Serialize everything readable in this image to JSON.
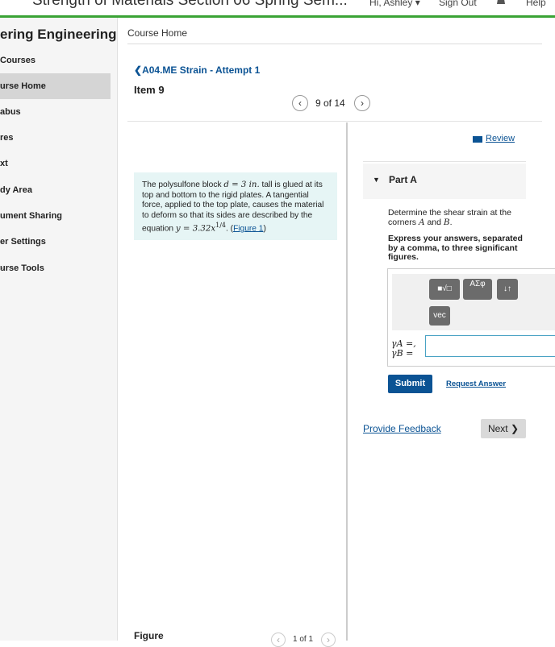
{
  "topbar": {
    "course_title": "Strength of Materials Section 06 Spring Sem...",
    "user_menu": "Hi, Ashley ▾",
    "sign_out": "Sign Out",
    "help": "Help"
  },
  "sidebar": {
    "brand": "ering Engineering",
    "items": [
      {
        "label": "Courses"
      },
      {
        "label": "urse Home"
      },
      {
        "label": "abus"
      },
      {
        "label": "res"
      },
      {
        "label": "xt"
      },
      {
        "label": "dy Area"
      },
      {
        "label": "ument Sharing"
      },
      {
        "label": "er Settings"
      },
      {
        "label": "urse Tools"
      }
    ],
    "active_index": 1
  },
  "breadcrumb": "Course Home",
  "assignment": {
    "back_link": "A04.ME Strain - Attempt 1",
    "item_title": "Item 9",
    "item_count": "9 of 14"
  },
  "problem": {
    "t1": "The polysulfone block ",
    "m1": "d = 3 in.",
    "t2": " tall is glued at its top and bottom to the rigid plates. A tangential force, applied to the top plate, causes the material to deform so that its sides are described by the equation ",
    "m2": "y = 3.32x",
    "m2_sup": "1/4",
    "t3": ". (",
    "figure_link": "Figure 1",
    "t4": ")"
  },
  "figure": {
    "label": "Figure",
    "count": "1 of 1"
  },
  "right_panel": {
    "review": "Review",
    "part_label": "Part A",
    "question_pre": "Determine the shear strain at the corners ",
    "question_A": "A",
    "question_and": " and ",
    "question_B": "B",
    "question_post": ".",
    "instructions": "Express your answers, separated by a comma, to three significant figures.",
    "toolbar": {
      "template_btn": "■√□",
      "greek_btn": "ΑΣφ",
      "arrows_btn": "↓↑",
      "vec_btn": "vec"
    },
    "math_label_a": "γA =,",
    "math_label_b": "γB =",
    "answer_value": "",
    "submit": "Submit",
    "request_answer": "Request Answer",
    "feedback": "Provide Feedback",
    "next": "Next ❯"
  }
}
